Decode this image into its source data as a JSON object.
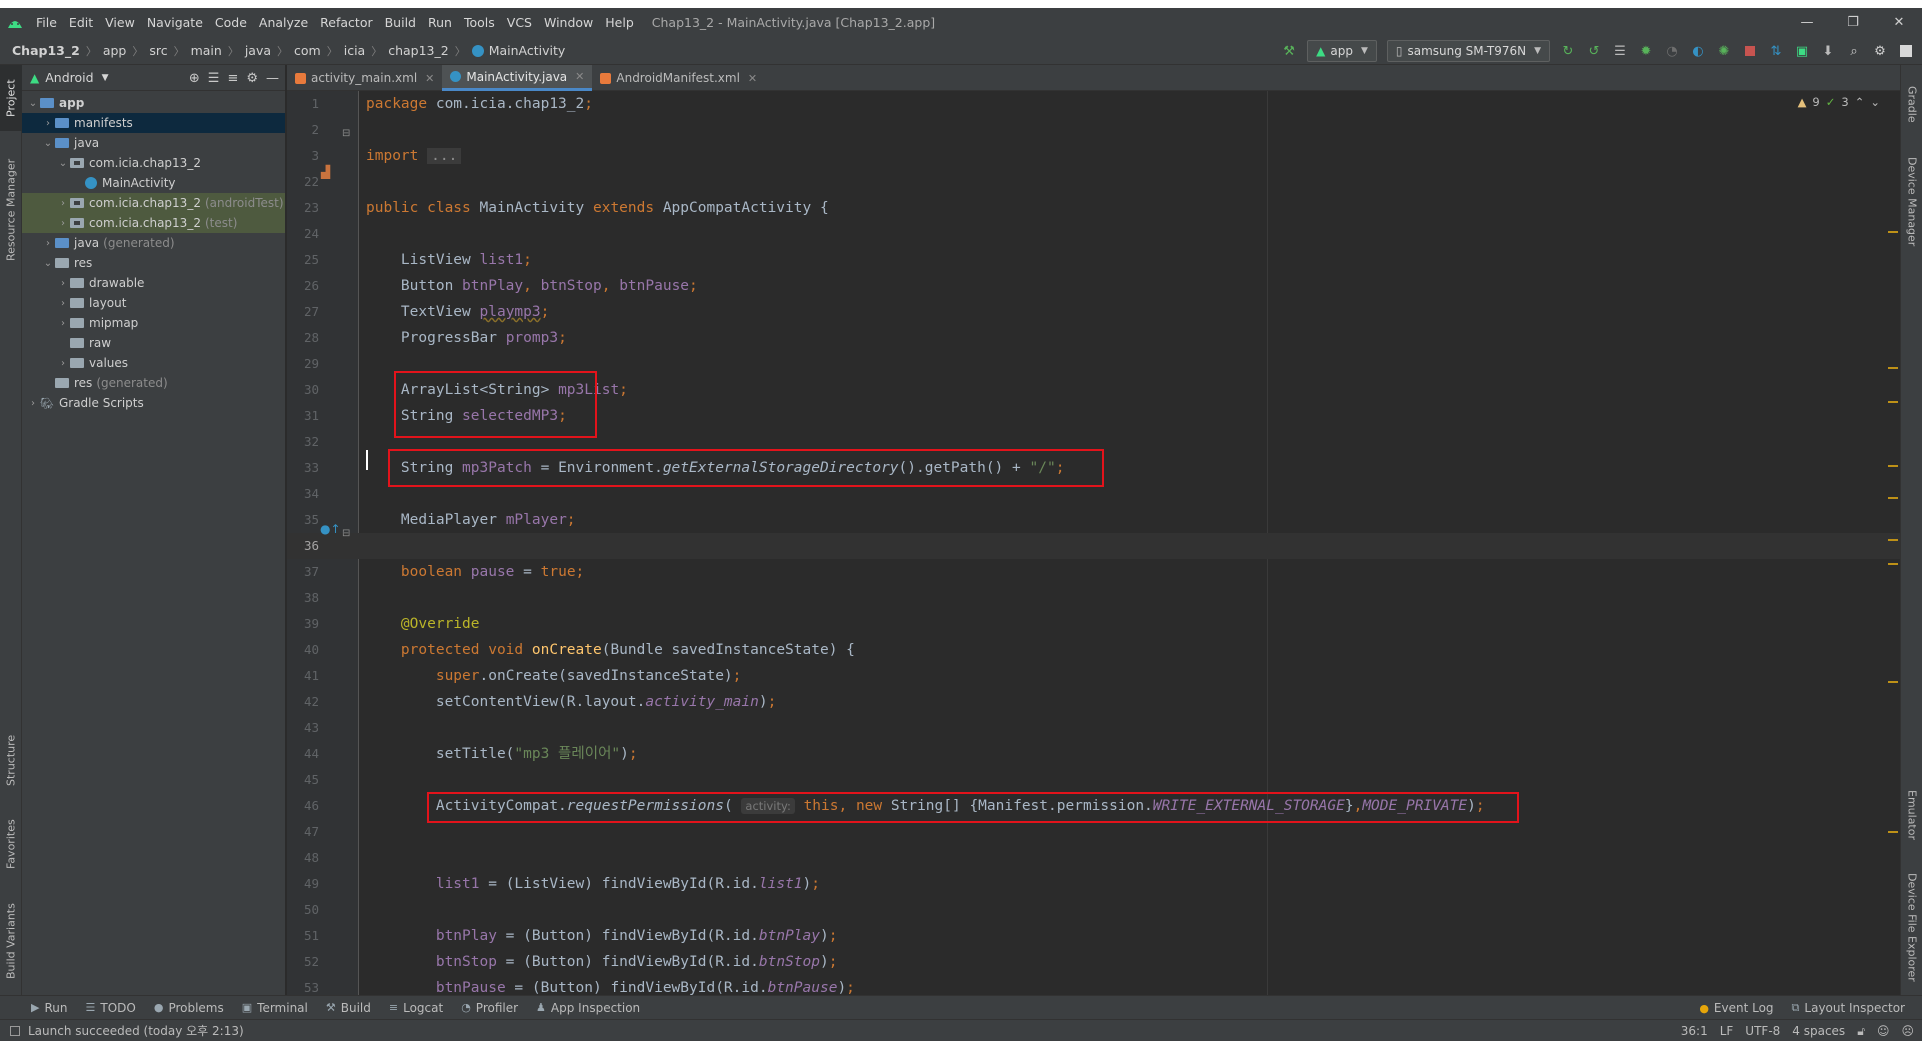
{
  "menu": [
    "File",
    "Edit",
    "View",
    "Navigate",
    "Code",
    "Analyze",
    "Refactor",
    "Build",
    "Run",
    "Tools",
    "VCS",
    "Window",
    "Help"
  ],
  "window_title": "Chap13_2 - MainActivity.java [Chap13_2.app]",
  "window_controls": {
    "minimize": "—",
    "restore": "❐",
    "close": "✕"
  },
  "breadcrumbs": [
    "Chap13_2",
    "app",
    "src",
    "main",
    "java",
    "com",
    "icia",
    "chap13_2",
    "MainActivity"
  ],
  "toolbar": {
    "run_config": "app",
    "device": "samsung SM-T976N"
  },
  "project_panel": {
    "view_label": "Android",
    "tree": [
      {
        "label": "app",
        "depth": 0,
        "expanded": true,
        "kind": "module"
      },
      {
        "label": "manifests",
        "depth": 1,
        "expanded": false,
        "kind": "folder-blue",
        "selected": true
      },
      {
        "label": "java",
        "depth": 1,
        "expanded": true,
        "kind": "folder-blue"
      },
      {
        "label": "com.icia.chap13_2",
        "depth": 2,
        "expanded": true,
        "kind": "package"
      },
      {
        "label": "MainActivity",
        "depth": 3,
        "kind": "class"
      },
      {
        "label": "com.icia.chap13_2",
        "suffix": "(androidTest)",
        "depth": 2,
        "expanded": false,
        "kind": "package",
        "highlight": true
      },
      {
        "label": "com.icia.chap13_2",
        "suffix": "(test)",
        "depth": 2,
        "expanded": false,
        "kind": "package",
        "highlight": true
      },
      {
        "label": "java",
        "suffix": "(generated)",
        "depth": 1,
        "expanded": false,
        "kind": "folder-blue"
      },
      {
        "label": "res",
        "depth": 1,
        "expanded": true,
        "kind": "folder-grey"
      },
      {
        "label": "drawable",
        "depth": 2,
        "expanded": false,
        "kind": "folder-grey"
      },
      {
        "label": "layout",
        "depth": 2,
        "expanded": false,
        "kind": "folder-grey"
      },
      {
        "label": "mipmap",
        "depth": 2,
        "expanded": false,
        "kind": "folder-grey"
      },
      {
        "label": "raw",
        "depth": 2,
        "kind": "folder-grey"
      },
      {
        "label": "values",
        "depth": 2,
        "expanded": false,
        "kind": "folder-grey"
      },
      {
        "label": "res",
        "suffix": "(generated)",
        "depth": 1,
        "kind": "folder-grey"
      },
      {
        "label": "Gradle Scripts",
        "depth": 0,
        "expanded": false,
        "kind": "gradle"
      }
    ]
  },
  "left_tabs": {
    "project": "Project",
    "resource_manager": "Resource Manager",
    "structure": "Structure",
    "favorites": "Favorites",
    "build_variants": "Build Variants"
  },
  "right_tabs": {
    "gradle": "Gradle",
    "device_manager": "Device Manager",
    "emulator": "Emulator",
    "device_file_explorer": "Device File Explorer"
  },
  "editor_tabs": [
    {
      "label": "activity_main.xml",
      "type": "xml",
      "active": false
    },
    {
      "label": "MainActivity.java",
      "type": "java",
      "active": true
    },
    {
      "label": "AndroidManifest.xml",
      "type": "xml",
      "active": false
    }
  ],
  "inspections": {
    "warnings": "9",
    "ok": "3"
  },
  "code_lines": [
    {
      "n": "1",
      "html": "<span class='kw'>package</span> com.icia.chap13_2<span class='kw'>;</span>"
    },
    {
      "n": "2",
      "html": ""
    },
    {
      "n": "3",
      "html": "<span class='kw'>import</span> <span class='fold'>...</span>"
    },
    {
      "n": "22",
      "html": ""
    },
    {
      "n": "23",
      "html": "<span class='kw'>public class</span> MainActivity <span class='kw'>extends</span> AppCompatActivity {"
    },
    {
      "n": "24",
      "html": ""
    },
    {
      "n": "25",
      "html": "    ListView <span class='fld'>list1</span><span class='kw'>;</span>"
    },
    {
      "n": "26",
      "html": "    Button <span class='fld'>btnPlay</span><span class='kw'>, </span><span class='fld'>btnStop</span><span class='kw'>, </span><span class='fld'>btnPause</span><span class='kw'>;</span>"
    },
    {
      "n": "27",
      "html": "    TextView <span class='fld' style='text-decoration: underline wavy #8a6f2a;'>playmp3</span><span class='kw'>;</span>"
    },
    {
      "n": "28",
      "html": "    ProgressBar <span class='fld'>promp3</span><span class='kw'>;</span>"
    },
    {
      "n": "29",
      "html": ""
    },
    {
      "n": "30",
      "html": "    ArrayList&lt;String&gt; <span class='fld'>mp3List</span><span class='kw'>;</span>"
    },
    {
      "n": "31",
      "html": "    String <span class='fld'>selectedMP3</span><span class='kw'>;</span>"
    },
    {
      "n": "32",
      "html": ""
    },
    {
      "n": "33",
      "html": "    String <span class='fld'>mp3Patch</span> = Environment.<span class='it'>getExternalStorageDirectory</span>().getPath() + <span class='str'>\"/\"</span><span class='kw'>;</span>"
    },
    {
      "n": "34",
      "html": ""
    },
    {
      "n": "35",
      "html": "    MediaPlayer <span class='fld'>mPlayer</span><span class='kw'>;</span>"
    },
    {
      "n": "36",
      "html": ""
    },
    {
      "n": "37",
      "html": "    <span class='kw'>boolean</span> <span class='fld'>pause</span> = <span class='kw'>true;</span>"
    },
    {
      "n": "38",
      "html": ""
    },
    {
      "n": "39",
      "html": "    <span class='ann'>@Override</span>"
    },
    {
      "n": "40",
      "html": "    <span class='kw'>protected void</span> <span class='fn'>onCreate</span>(Bundle savedInstanceState) {"
    },
    {
      "n": "41",
      "html": "        <span class='kw'>super</span>.onCreate(savedInstanceState)<span class='kw'>;</span>"
    },
    {
      "n": "42",
      "html": "        setContentView(R.layout.<span class='st'>activity_main</span>)<span class='kw'>;</span>"
    },
    {
      "n": "43",
      "html": ""
    },
    {
      "n": "44",
      "html": "        setTitle(<span class='str'>\"mp3 플레이어\"</span>)<span class='kw'>;</span>"
    },
    {
      "n": "45",
      "html": ""
    },
    {
      "n": "46",
      "html": "        ActivityCompat.<span class='it'>requestPermissions</span>( <span class='hint'>activity:</span> <span class='kw'>this, new</span> String[] {Manifest.permission.<span class='st'>WRITE_EXTERNAL_STORAGE</span>}<span class='kw'>,</span><span class='st'>MODE_PRIVATE</span>)<span class='kw'>;</span>"
    },
    {
      "n": "47",
      "html": ""
    },
    {
      "n": "48",
      "html": ""
    },
    {
      "n": "49",
      "html": "        <span class='fld'>list1</span> = (ListView) findViewById(R.id.<span class='st'>list1</span>)<span class='kw'>;</span>"
    },
    {
      "n": "50",
      "html": ""
    },
    {
      "n": "51",
      "html": "        <span class='fld'>btnPlay</span> = (Button) findViewById(R.id.<span class='st'>btnPlay</span>)<span class='kw'>;</span>"
    },
    {
      "n": "52",
      "html": "        <span class='fld'>btnStop</span> = (Button) findViewById(R.id.<span class='st'>btnStop</span>)<span class='kw'>;</span>"
    },
    {
      "n": "53",
      "html": "        <span class='fld'>btnPause</span> = (Button) findViewById(R.id.<span class='st'>btnPause</span>)<span class='kw'>;</span>"
    }
  ],
  "current_line": "36",
  "bottom_tools": [
    {
      "label": "Run",
      "icon": "play-icon"
    },
    {
      "label": "TODO",
      "icon": "list-icon"
    },
    {
      "label": "Problems",
      "icon": "problems-icon"
    },
    {
      "label": "Terminal",
      "icon": "terminal-icon"
    },
    {
      "label": "Build",
      "icon": "hammer-icon"
    },
    {
      "label": "Logcat",
      "icon": "logcat-icon"
    },
    {
      "label": "Profiler",
      "icon": "gauge-icon"
    },
    {
      "label": "App Inspection",
      "icon": "inspection-icon"
    }
  ],
  "bottom_right_tools": [
    {
      "label": "Event Log",
      "icon": "event-log-icon"
    },
    {
      "label": "Layout Inspector",
      "icon": "layout-inspector-icon"
    }
  ],
  "status": {
    "message": "Launch succeeded (today 오후 2:13)",
    "position": "36:1",
    "line_sep": "LF",
    "encoding": "UTF-8",
    "indent": "4 spaces"
  },
  "colors": {
    "accent": "#4a88c7",
    "highlight_box": "#e3131b",
    "android_green": "#3ddc84"
  }
}
